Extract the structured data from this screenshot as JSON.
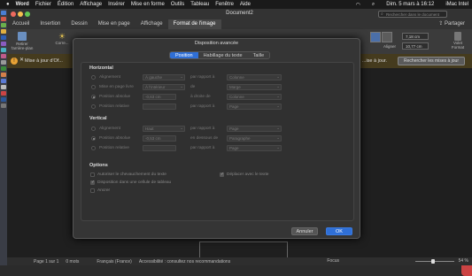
{
  "menubar": {
    "app": "Word",
    "items": [
      "Fichier",
      "Édition",
      "Affichage",
      "Insérer",
      "Mise en forme",
      "Outils",
      "Tableau",
      "Fenêtre",
      "Aide"
    ],
    "datetime": "Dim. 5 mars à 16:12",
    "computer": "iMac Intel"
  },
  "window": {
    "title": "Document2",
    "search_placeholder": "Rechercher dans le document"
  },
  "ribbon": {
    "tabs": [
      "Accueil",
      "Insertion",
      "Dessin",
      "Mise en page",
      "Affichage",
      "Format de l'image"
    ],
    "active_tab": "Format de l'image",
    "share_label": "Partager",
    "remove_bg_label": "Retirer l'arrière-plan",
    "corrections_label": "Corre...",
    "align_label": "Aligner",
    "width_value": "7,18 cm",
    "height_value": "10,77 cm",
    "format_pane_label": "Volet Format"
  },
  "infobar": {
    "text": "Mise à jour d'Of...",
    "suffix_text": "...ise à jour.",
    "button_label": "Rechercher les mises à jour"
  },
  "dialog": {
    "title": "Disposition avancée",
    "tabs": [
      "Position",
      "Habillage du texte",
      "Taille"
    ],
    "active_tab": "Position",
    "horizontal": {
      "heading": "Horizontal",
      "alignment": {
        "label": "Alignement",
        "value": "À gauche",
        "rel_text": "par rapport à",
        "rel_value": "Colonne"
      },
      "book_layout": {
        "label": "Mise en page livre",
        "value": "À l'intérieur",
        "rel_text": "de",
        "rel_value": "Marge"
      },
      "absolute": {
        "label": "Position absolue",
        "value": "-0,63 cm",
        "rel_text": "à droite de",
        "rel_value": "Colonne"
      },
      "relative": {
        "label": "Position relative",
        "value": "",
        "rel_text": "par rapport à",
        "rel_value": "Page"
      }
    },
    "vertical": {
      "heading": "Vertical",
      "alignment": {
        "label": "Alignement",
        "value": "Haut",
        "rel_text": "par rapport à",
        "rel_value": "Page"
      },
      "absolute": {
        "label": "Position absolue",
        "value": "-0,53 cm",
        "rel_text": "en dessous de",
        "rel_value": "Paragraphe"
      },
      "relative": {
        "label": "Position relative",
        "value": "",
        "rel_text": "par rapport à",
        "rel_value": "Page"
      }
    },
    "options": {
      "heading": "Options",
      "allow_overlap": "Autoriser le chevauchement du texte",
      "in_table_cell": "Disposition dans une cellule de tableau",
      "anchor": "Ancrer",
      "move_with_text": "Déplacer avec le texte"
    },
    "cancel_label": "Annuler",
    "ok_label": "OK"
  },
  "statusbar": {
    "page": "Page 1 sur 1",
    "words": "0 mots",
    "language": "Français (France)",
    "accessibility": "Accessibilité : consultez nos recommandations",
    "focus": "Focus",
    "zoom": "54 %"
  }
}
